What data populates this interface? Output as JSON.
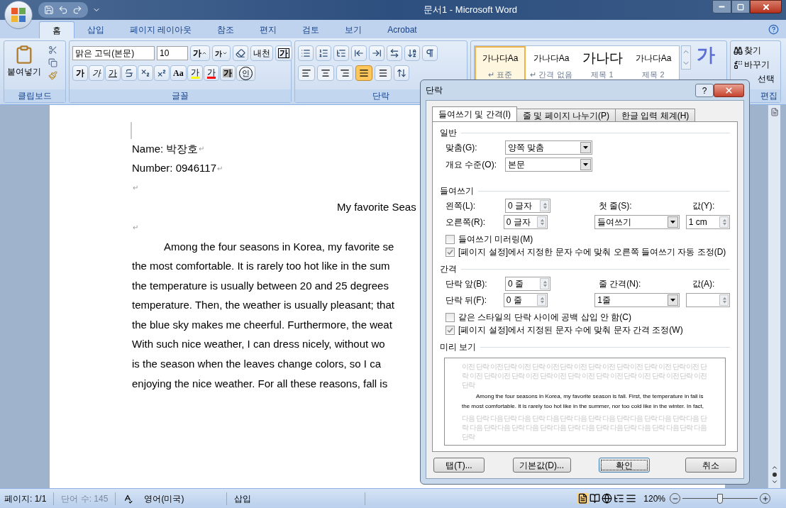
{
  "window": {
    "title": "문서1 - Microsoft Word"
  },
  "ribbon_tabs": [
    {
      "label": "홈",
      "selected": true
    },
    {
      "label": "삽입",
      "selected": false
    },
    {
      "label": "페이지 레이아웃",
      "selected": false
    },
    {
      "label": "참조",
      "selected": false
    },
    {
      "label": "편지",
      "selected": false
    },
    {
      "label": "검토",
      "selected": false
    },
    {
      "label": "보기",
      "selected": false
    },
    {
      "label": "Acrobat",
      "selected": false
    }
  ],
  "clipboard": {
    "paste": "붙여넣기",
    "label": "클립보드"
  },
  "font": {
    "name": "맑은 고딕(본문)",
    "size": "10",
    "label": "글꼴",
    "row1": [
      {
        "kind": "grow",
        "label": "가"
      },
      {
        "kind": "shrink",
        "label": "가"
      },
      {
        "kind": "clear"
      },
      {
        "kind": "phonetic",
        "label": "내천"
      },
      {
        "kind": "border",
        "label": "가"
      }
    ],
    "row2": [
      {
        "kind": "bold",
        "label": "가"
      },
      {
        "kind": "italic",
        "label": "가"
      },
      {
        "kind": "underline",
        "label": "가"
      },
      {
        "kind": "strike"
      },
      {
        "kind": "sub"
      },
      {
        "kind": "sup"
      },
      {
        "kind": "case",
        "label": "Aa"
      },
      {
        "kind": "highlight",
        "label": "가"
      },
      {
        "kind": "color",
        "label": "가"
      },
      {
        "kind": "shading",
        "label": "가"
      },
      {
        "kind": "enclose",
        "label": "인"
      }
    ]
  },
  "paragraph": {
    "label": "단락",
    "alignments": [
      {
        "kind": "left",
        "selected": false
      },
      {
        "kind": "center",
        "selected": false
      },
      {
        "kind": "right",
        "selected": false
      },
      {
        "kind": "justify",
        "selected": true
      },
      {
        "kind": "distribute",
        "selected": false
      }
    ]
  },
  "styles": [
    {
      "preview": "가나다Aa",
      "name": "↵ 표준",
      "selected": true,
      "kind": "normal"
    },
    {
      "preview": "가나다Aa",
      "name": "↵ 간격 없음",
      "selected": false,
      "kind": "normal"
    },
    {
      "preview": "가나다",
      "name": "제목 1",
      "selected": false,
      "kind": "large"
    },
    {
      "preview": "가나다Aa",
      "name": "제목 2",
      "selected": false,
      "kind": "normal"
    }
  ],
  "change_styles": "가",
  "editing": {
    "find": "찾기",
    "replace": "바꾸기",
    "select": "선택",
    "label": "편집"
  },
  "document": {
    "lines": [
      {
        "kind": "plain",
        "text": "Name: 박장호",
        "mark": "↵"
      },
      {
        "kind": "plain",
        "text": "Number: 0946117",
        "mark": "↵"
      },
      {
        "kind": "plain",
        "mark": "↵"
      },
      {
        "kind": "title",
        "text": "My favorite Seas"
      },
      {
        "kind": "plain",
        "mark": "↵"
      },
      {
        "kind": "first",
        "text": "Among the four seasons in Korea, my favorite se"
      },
      {
        "kind": "plain",
        "text": "the most comfortable. It is rarely too hot like in the sum"
      },
      {
        "kind": "plain",
        "text": "the temperature is usually between 20 and 25 degrees"
      },
      {
        "kind": "plain",
        "text": "temperature. Then, the weather is usually pleasant; that"
      },
      {
        "kind": "plain",
        "text": "the blue sky makes me cheerful. Furthermore, the weat"
      },
      {
        "kind": "plain",
        "text": "With such nice weather, I can dress nicely, without wo"
      },
      {
        "kind": "plain",
        "text": "is the season when the leaves change colors, so I ca"
      },
      {
        "kind": "plain",
        "text": "enjoying the nice weather. For all these reasons, fall is"
      }
    ]
  },
  "status_bar": {
    "page": "페이지: 1/1",
    "words": "단어 수: 145",
    "language": "영어(미국)",
    "mode": "삽입",
    "zoom": "120%",
    "zoom_slider": {
      "level": 0.5
    }
  },
  "dialog": {
    "title": "단락",
    "help": "?",
    "tabs": [
      {
        "label": "들여쓰기 및 간격(I)",
        "selected": true
      },
      {
        "label": "줄 및 페이지 나누기(P)",
        "selected": false
      },
      {
        "label": "한글 입력 체계(H)",
        "selected": false
      }
    ],
    "general": {
      "heading": "일반",
      "alignment": {
        "label": "맞춤(G):",
        "value": "양쪽 맞춤"
      },
      "outline": {
        "label": "개요 수준(O):",
        "value": "본문"
      }
    },
    "indent": {
      "heading": "들여쓰기",
      "left": {
        "label": "왼쪽(L):",
        "value": "0 글자"
      },
      "right": {
        "label": "오른쪽(R):",
        "value": "0 글자"
      },
      "special": {
        "label": "첫 줄(S):",
        "value": "들여쓰기"
      },
      "by": {
        "label": "값(Y):",
        "value": "1 cm"
      },
      "checks": [
        {
          "label": "들여쓰기 미러링(M)",
          "checked": false
        },
        {
          "label": "[페이지 설정]에서 지정한 문자 수에 맞춰 오른쪽 들여쓰기 자동 조정(D)",
          "checked": true
        }
      ]
    },
    "spacing": {
      "heading": "간격",
      "before": {
        "label": "단락 앞(B):",
        "value": "0 줄"
      },
      "after": {
        "label": "단락 뒤(F):",
        "value": "0 줄"
      },
      "line": {
        "label": "줄 간격(N):",
        "value": "1줄"
      },
      "at": {
        "label": "값(A):"
      },
      "checks": [
        {
          "label": "같은 스타일의 단락 사이에 공백 삽입 안 함(C)",
          "checked": false
        },
        {
          "label": "[페이지 설정]에서 지정된 문자 수에 맞춰 문자 간격 조정(W)",
          "checked": true
        }
      ]
    },
    "preview": {
      "heading": "미리 보기",
      "before": "이전 단락 이전 단락 이전 단락 이전 단락 이전 단락 이전 단락 이전 단락 이전 단락 이전 단락 이전 단락 이전 단락 이전 단락 이전 단락 이전 단락 이전 단락 이전 단락 이전 단락 이전 단락",
      "sample": "Among the four seasons in Korea, my favorite season is fall. First, the temperature in fall is the most comfortable. It is rarely too hot like in the summer, nor too cold like in the winter. In fact,",
      "after": "다음 단락 다음 단락 다음 단락 다음 단락 다음 단락 다음 단락 다음 단락 다음 단락 다음 단락 다음 단락 다음 단락 다음 단락 다음 단락 다음 단락 다음 단락 다음 단락 다음 단락 다음 단락"
    },
    "buttons": [
      {
        "label": "탭(T)...",
        "focused": false
      },
      {
        "label": "기본값(D)...",
        "focused": false
      },
      {
        "label": "확인",
        "focused": true
      },
      {
        "label": "취소",
        "focused": false
      }
    ]
  }
}
